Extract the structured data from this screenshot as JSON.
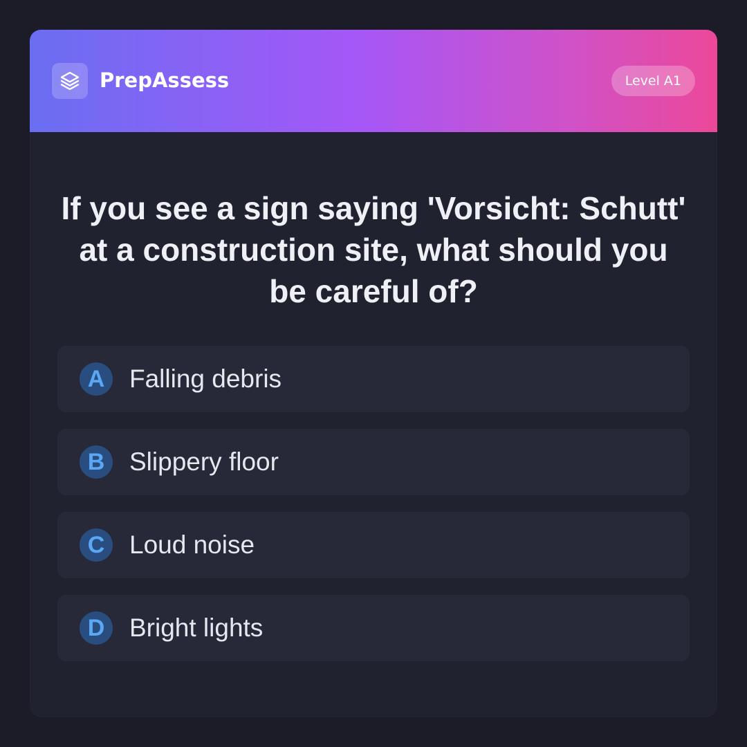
{
  "header": {
    "brand": "PrepAssess",
    "logo_icon": "layers-icon",
    "level_badge": "Level A1"
  },
  "question": {
    "text": "If you see a sign saying 'Vorsicht: Schutt' at a construction site, what should you be careful of?"
  },
  "options": [
    {
      "letter": "A",
      "text": "Falling debris"
    },
    {
      "letter": "B",
      "text": "Slippery floor"
    },
    {
      "letter": "C",
      "text": "Loud noise"
    },
    {
      "letter": "D",
      "text": "Bright lights"
    }
  ],
  "colors": {
    "background": "#1b1c28",
    "card": "#20222f",
    "option_bg": "#272938",
    "letter_bg": "#2a4d80",
    "letter_fg": "#5aa7f5",
    "gradient_start": "#6a6ef2",
    "gradient_mid": "#a657f7",
    "gradient_end": "#ec4899"
  }
}
